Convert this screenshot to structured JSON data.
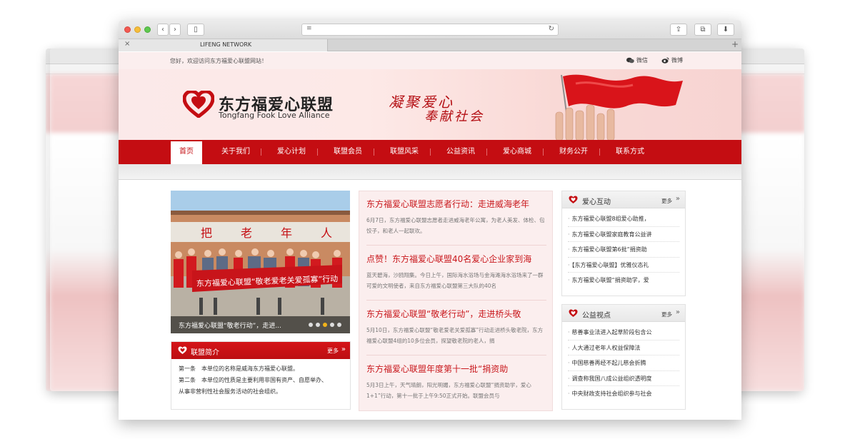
{
  "browser": {
    "tab_title": "LIFENG NETWORK",
    "back_glyph": "‹",
    "forward_glyph": "›",
    "sidebar_glyph": "▯",
    "close_tab_glyph": "×",
    "new_tab_glyph": "+",
    "reload_glyph": "↻",
    "share_glyph": "⇪",
    "tabs_glyph": "⧉",
    "download_glyph": "⬇",
    "reader_glyph": "≡"
  },
  "topbar": {
    "welcome": "您好，欢迎访问东方福爱心联盟网站！",
    "wechat": "微信",
    "weibo": "微博"
  },
  "header": {
    "logo_cn": "东方福爱心联盟",
    "logo_en": "Tongfang Fook Love Alliance",
    "slogan_line1": "凝聚爱心",
    "slogan_line2": "奉献社会"
  },
  "nav": {
    "items": [
      "首页",
      "关于我们",
      "爱心计划",
      "联盟会员",
      "联盟风采",
      "公益资讯",
      "爱心商城",
      "财务公开",
      "联系方式"
    ]
  },
  "slider": {
    "caption": "东方福爱心联盟“敬老行动”，走进...",
    "banner_text": "东方福爱心联盟“敬老爱老关爱孤寡”行动",
    "wall_chars": [
      "把",
      "老",
      "年",
      "人"
    ],
    "active_dot": 2,
    "dot_count": 5
  },
  "intro": {
    "title": "联盟简介",
    "more": "更多",
    "arrow": "»",
    "lines": [
      "第一条　本单位的名称是威海东方福爱心联盟。",
      "第二条　本单位的性质是主要利用非国有资产、自愿举办、",
      "从事非营利性社会服务活动的社会组织。"
    ]
  },
  "news": [
    {
      "title": "东方福爱心联盟志愿者行动：走进威海老年",
      "desc": "6月7日，东方福爱心联盟志愿者走进威海老年公寓，为老人美发、体检、包饺子，和老人一起联欢。"
    },
    {
      "title": "点赞！东方福爱心联盟40名爱心企业家到海",
      "desc": "蓝天碧海，沙鸥翔集。今日上午，国际海水浴场与金海滩海水浴场来了一群可爱的文明使者，来自东方福爱心联盟第三大队的40名"
    },
    {
      "title": "东方福爱心联盟“敬老行动”，走进桥头敬",
      "desc": "5月10日，东方福爱心联盟“敬老爱老关爱孤寡”行动走进桥头敬老院，东方福爱心联盟4组的10多位会员，探望敬老院的老人，捐"
    },
    {
      "title": "东方福爱心联盟年度第十一批“捐资助",
      "desc": "5月3日上午，天气晴朗，阳光明媚，东方福爱心联盟“捐资助学，爱心1+1”行动，第十一批于上午9:50正式开始。联盟会员与"
    }
  ],
  "love_interaction": {
    "title": "爱心互动",
    "more": "更多",
    "arrow": "»",
    "items": [
      "东方福爱心联盟8组爱心助推，",
      "东方福爱心联盟家庭教育公益讲",
      "东方福爱心联盟第6批“捐资助",
      "【东方福爱心联盟】优雅仪态礼",
      "东方福爱心联盟“捐资助学，爱"
    ]
  },
  "public_view": {
    "title": "公益视点",
    "more": "更多",
    "arrow": "»",
    "items": [
      "慈善事业法进入起草阶段包含公",
      "人大通过老年人权益保障法",
      "中国慈善再经不起儿慈会折腾",
      "调查称我国八成公益组织透明度",
      "中央财政支持社会组织参与社会"
    ]
  },
  "colors": {
    "brand_red": "#c40d12",
    "title_red": "#c9181d"
  }
}
